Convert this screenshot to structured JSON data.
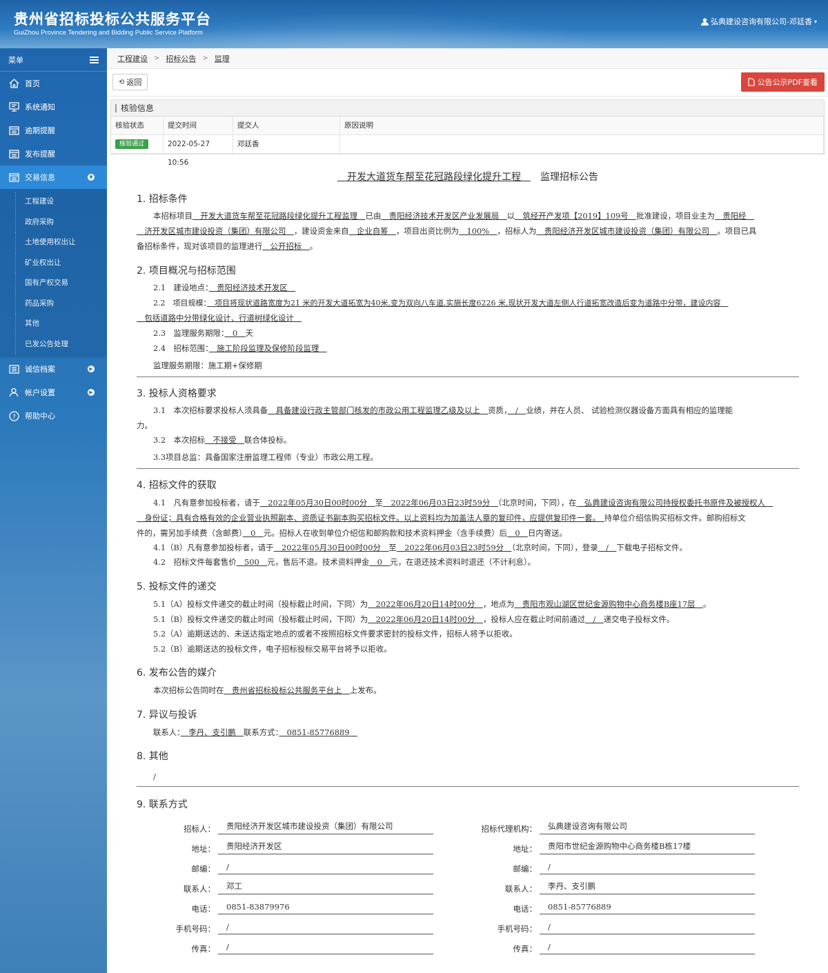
{
  "header": {
    "title": "贵州省招标投标公共服务平台",
    "subtitle": "GuiZhou Province Tendering and Bidding Public Service Platform",
    "user": "弘典建设咨询有限公司-邓廷香"
  },
  "sidebar": {
    "menu_label": "菜单",
    "items": [
      {
        "label": "首页",
        "icon": "home-icon"
      },
      {
        "label": "系统通知",
        "icon": "monitor-icon"
      },
      {
        "label": "逾期提醒",
        "icon": "list-icon"
      },
      {
        "label": "发布提醒",
        "icon": "list-icon"
      },
      {
        "label": "交易信息",
        "icon": "list-icon"
      }
    ],
    "sub_items": [
      "工程建设",
      "政府采购",
      "土地使用权出让",
      "矿业权出让",
      "国有产权交易",
      "药品采购",
      "其他",
      "已发公告处理"
    ],
    "lower_items": [
      {
        "label": "诚信档案",
        "icon": "list-icon"
      },
      {
        "label": "帐户设置",
        "icon": "user-icon"
      },
      {
        "label": "帮助中心",
        "icon": "help-icon"
      }
    ]
  },
  "breadcrumb": [
    "工程建设",
    "招标公告",
    "监理"
  ],
  "toolbar": {
    "back": "返回",
    "pdf": "公告公示PDF查看"
  },
  "verify": {
    "title": "核验信息",
    "headers": [
      "核验状态",
      "提交时间",
      "提交人",
      "原因说明"
    ],
    "status": "核验通过",
    "time": "2022-05-27 10:56",
    "person": "邓廷香",
    "reason": ""
  },
  "doc": {
    "title_u": "开发大道货车帮至花冠路段绿化提升工程",
    "title_tail": "监理招标公告",
    "s1": "1. 招标条件",
    "s1p1": [
      "本招标项目",
      "开发大道货车帮至花冠路段绿化提升工程监理",
      "已由",
      "贵阳经济技术开发区产业发展局",
      "以",
      "筑经开产发项【2019】109号",
      "批准建设，项目业主为",
      "贵阳经"
    ],
    "s1p2": [
      "济开发区城市建设投资（集团）有限公司",
      "，建设资金来自",
      "企业自筹",
      "，项目出资比例为",
      "100%",
      "，招标人为",
      "贵阳经济开发区城市建设投资（集团）有限公司",
      "。项目已具"
    ],
    "s1p3": [
      "备招标条件，现对该项目的监理进行",
      "公开招标",
      "。"
    ],
    "s2": "2. 项目概况与招标范围",
    "s2a": [
      "2.1　建设地点：",
      "贵阳经济技术开发区"
    ],
    "s2b": [
      "2.2　项目规模：",
      "项目将现状道路宽度为21 米的开发大道拓宽为40米,变为双向八车道,实施长度6226 米,现状开发大道左侧人行道拓宽改造后变为道路中分带，建设内容"
    ],
    "s2b2": "包括道路中分带绿化设计、行道树绿化设计",
    "s2c": [
      "2.3　监理服务期限：",
      "0",
      "天"
    ],
    "s2d": [
      "2.4　招标范围：",
      "施工阶段监理及保修阶段监理"
    ],
    "s2e": "监理服务期限：施工期+保修期",
    "s3": "3. 投标人资格要求",
    "s3a": [
      "3.1　本次招标要求投标人须具备",
      "具备建设行政主管部门核发的市政公用工程监理乙级及以上",
      "资质，",
      "/",
      "业绩，并在人员、 试验检测仪器设备方面具有相应的监理能"
    ],
    "s3a2": "力。",
    "s3b": [
      "3.2　本次招标",
      "不接受",
      "联合体投标。"
    ],
    "s3c": "3.3项目总监：具备国家注册监理工程师（专业）市政公用工程。",
    "s4": "4. 招标文件的获取",
    "s4a": [
      "4.1　凡有意参加投标者，请于",
      "2022年05月30日00时00分",
      "至",
      "2022年06月03日23时59分",
      "（北京时间，下同），在",
      "弘典建设咨询有限公司持授权委托书原件及被授权人"
    ],
    "s4a2": [
      "身份证；具有合格有效的企业营业执照副本、资质证书副本购买招标文件。以上资料均为加盖法人章的复印件，应提供复印件一套。",
      "持单位介绍信购买招标文件。邮购招标文"
    ],
    "s4a3": [
      "件的，需另加手续费（含邮费）",
      "0",
      "元。招标人在收到单位介绍信和邮购款和技术资料押金（含手续费）后",
      "0",
      "日内寄送。"
    ],
    "s4b": [
      "4.1（B）凡有意参加投标者，请于",
      "2022年05月30日00时00分",
      "至",
      "2022年06月03日23时59分",
      "（北京时间，下同），登录",
      "/",
      "下载电子招标文件。"
    ],
    "s4c": [
      "4.2　招标文件每套售价",
      "500",
      "元，售后不退。技术资料押金",
      "0",
      "元，在退还技术资料时退还（不计利息）。"
    ],
    "s5": "5. 投标文件的递交",
    "s5a": [
      "5.1（A）投标文件递交的截止时间（投标截止时间，下同）为",
      "2022年06月20日14时00分",
      "，地点为",
      "贵阳市观山湖区世纪金源购物中心商务楼B座17层",
      "。"
    ],
    "s5b": [
      "5.1（B）投标文件递交的截止时间（投标截止时间，下同）为",
      "2022年06月20日14时00分",
      "，投标人应在截止时间前通过",
      "/",
      "递交电子投标文件。"
    ],
    "s5c": "5.2（A）逾期送达的、未送达指定地点的或者不按照招标文件要求密封的投标文件，招标人将予以拒收。",
    "s5d": "5.2（B）逾期送达的投标文件，电子招标投标交易平台将予以拒收。",
    "s6": "6. 发布公告的媒介",
    "s6a": [
      "本次招标公告同时在",
      "贵州省招标投标公共服务平台上",
      "上发布。"
    ],
    "s7": "7. 异议与投诉",
    "s7a": [
      "联系人：",
      "李丹、支引鹏",
      "联系方式：",
      "0851-85776889"
    ],
    "s8": "8. 其他",
    "s8a": "/",
    "s9": "9. 联系方式",
    "left": [
      [
        "招标人：",
        "贵阳经济开发区城市建设投资（集团）有限公司"
      ],
      [
        "地址：",
        "贵阳经济开发区"
      ],
      [
        "邮编：",
        "/"
      ],
      [
        "联系人：",
        "邓工"
      ],
      [
        "电话：",
        "0851-83879976"
      ],
      [
        "手机号码：",
        "/"
      ],
      [
        "传真：",
        "/"
      ]
    ],
    "right": [
      [
        "招标代理机构：",
        "弘典建设咨询有限公司"
      ],
      [
        "地址：",
        "贵阳市世纪金源购物中心商务楼B栋17楼"
      ],
      [
        "邮编：",
        "/"
      ],
      [
        "联系人：",
        "李丹、支引鹏"
      ],
      [
        "电话：",
        "0851-85776889"
      ],
      [
        "手机号码：",
        "/"
      ],
      [
        "传真：",
        "/"
      ]
    ]
  }
}
